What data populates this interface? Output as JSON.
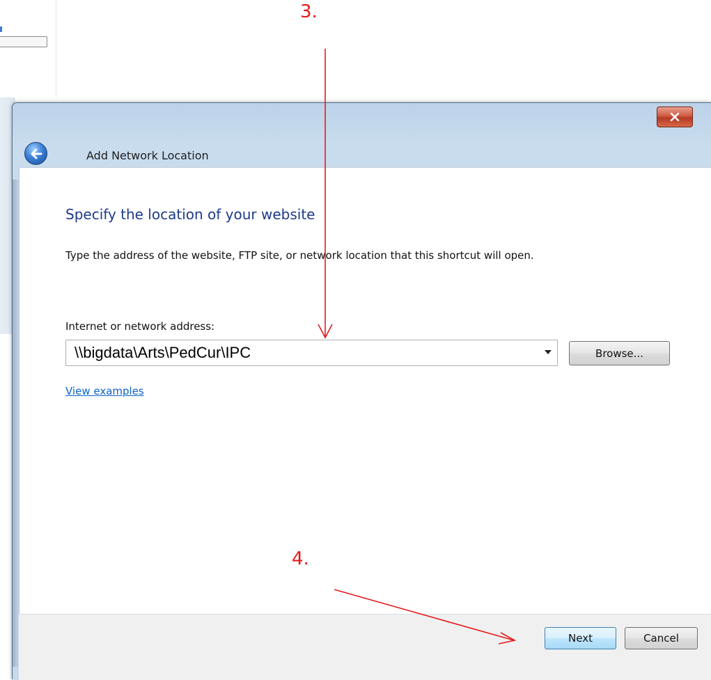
{
  "window": {
    "title": "Add Network Location",
    "close_label": "x"
  },
  "content": {
    "heading": "Specify the location of your website",
    "instruction": "Type the address of the website, FTP site, or network location that this shortcut will open.",
    "address_label": "Internet or network address:",
    "address_value": "\\\\bigdata\\Arts\\PedCur\\IPC",
    "browse_label": "Browse...",
    "view_examples_label": "View examples"
  },
  "footer": {
    "next_label": "Next",
    "cancel_label": "Cancel"
  },
  "annotations": {
    "step3": "3.",
    "step4": "4.",
    "color": "#e31b1b"
  },
  "background_text": "int",
  "icons": {
    "back": "back-arrow-icon",
    "close": "close-icon",
    "dropdown": "chevron-down-icon"
  }
}
